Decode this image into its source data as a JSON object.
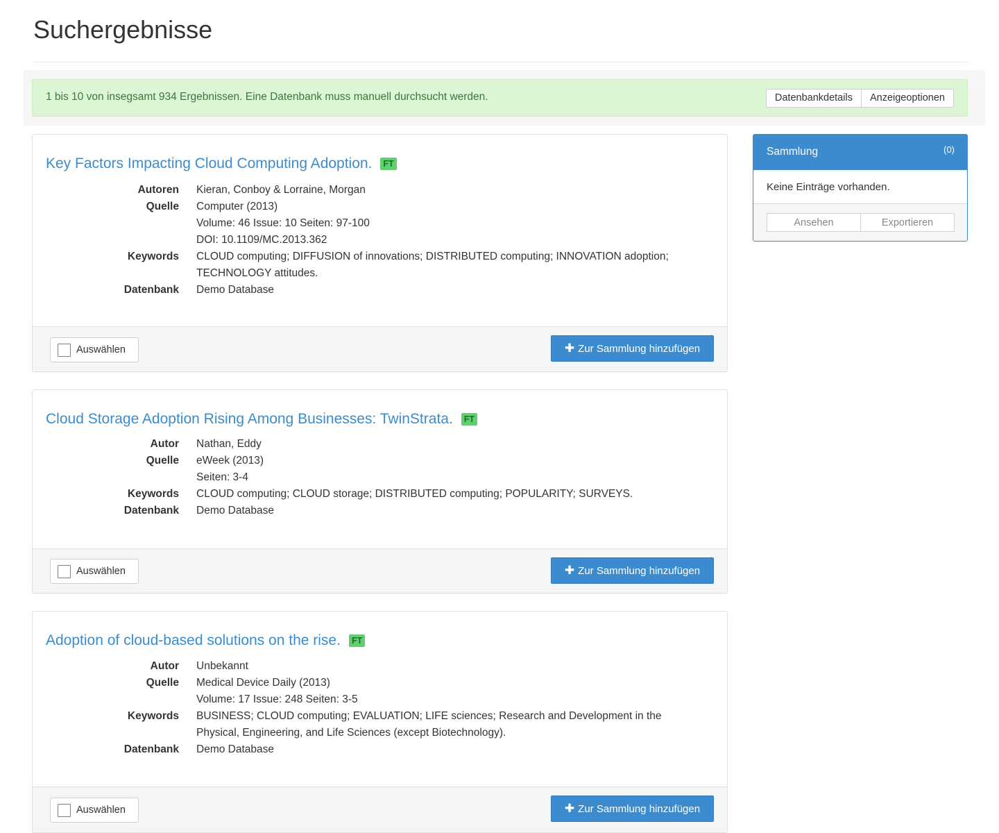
{
  "page": {
    "title": "Suchergebnisse"
  },
  "alert": {
    "text": "1 bis 10 von insegsamt 934 Ergebnissen. Eine Datenbank muss manuell durchsucht werden.",
    "buttons": [
      "Datenbankdetails",
      "Anzeigeoptionen"
    ]
  },
  "results": [
    {
      "title": "Key Factors Impacting Cloud Computing Adoption.",
      "badge": "FT",
      "fields": [
        {
          "label": "Autoren",
          "lines": [
            "Kieran, Conboy & Lorraine, Morgan"
          ]
        },
        {
          "label": "Quelle",
          "lines": [
            "Computer (2013)",
            "Volume: 46 Issue: 10 Seiten: 97-100",
            "DOI: 10.1109/MC.2013.362"
          ]
        },
        {
          "label": "Keywords",
          "lines": [
            "CLOUD computing; DIFFUSION of innovations; DISTRIBUTED computing; INNOVATION adoption;",
            "TECHNOLOGY attitudes."
          ]
        },
        {
          "label": "Datenbank",
          "lines": [
            "Demo Database"
          ]
        }
      ],
      "select_label": "Auswählen",
      "add_label": "Zur Sammlung hinzufügen"
    },
    {
      "title": "Cloud Storage Adoption Rising Among Businesses: TwinStrata.",
      "badge": "FT",
      "fields": [
        {
          "label": "Autor",
          "lines": [
            "Nathan, Eddy"
          ]
        },
        {
          "label": "Quelle",
          "lines": [
            "eWeek (2013)",
            "Seiten: 3-4"
          ]
        },
        {
          "label": "Keywords",
          "lines": [
            "CLOUD computing; CLOUD storage; DISTRIBUTED computing; POPULARITY; SURVEYS."
          ]
        },
        {
          "label": "Datenbank",
          "lines": [
            "Demo Database"
          ]
        }
      ],
      "select_label": "Auswählen",
      "add_label": "Zur Sammlung hinzufügen"
    },
    {
      "title": "Adoption of cloud-based solutions on the rise.",
      "badge": "FT",
      "fields": [
        {
          "label": "Autor",
          "lines": [
            "Unbekannt"
          ]
        },
        {
          "label": "Quelle",
          "lines": [
            "Medical Device Daily (2013)",
            "Volume: 17 Issue: 248 Seiten: 3-5"
          ]
        },
        {
          "label": "Keywords",
          "lines": [
            "BUSINESS; CLOUD computing; EVALUATION; LIFE sciences; Research and Development in the",
            "Physical, Engineering, and Life Sciences (except Biotechnology)."
          ]
        },
        {
          "label": "Datenbank",
          "lines": [
            "Demo Database"
          ]
        }
      ],
      "select_label": "Auswählen",
      "add_label": "Zur Sammlung hinzufügen"
    }
  ],
  "collection": {
    "title": "Sammlung",
    "count": "(0)",
    "empty_text": "Keine Einträge vorhanden.",
    "view_label": "Ansehen",
    "export_label": "Exportieren"
  },
  "colors": {
    "link": "#3a8cce",
    "primary": "#3d8bcf",
    "alert_bg": "#dcf5d4",
    "badge": "#5fcf6f"
  },
  "icons": {
    "add": "plus-icon",
    "select": "checkbox-icon"
  }
}
